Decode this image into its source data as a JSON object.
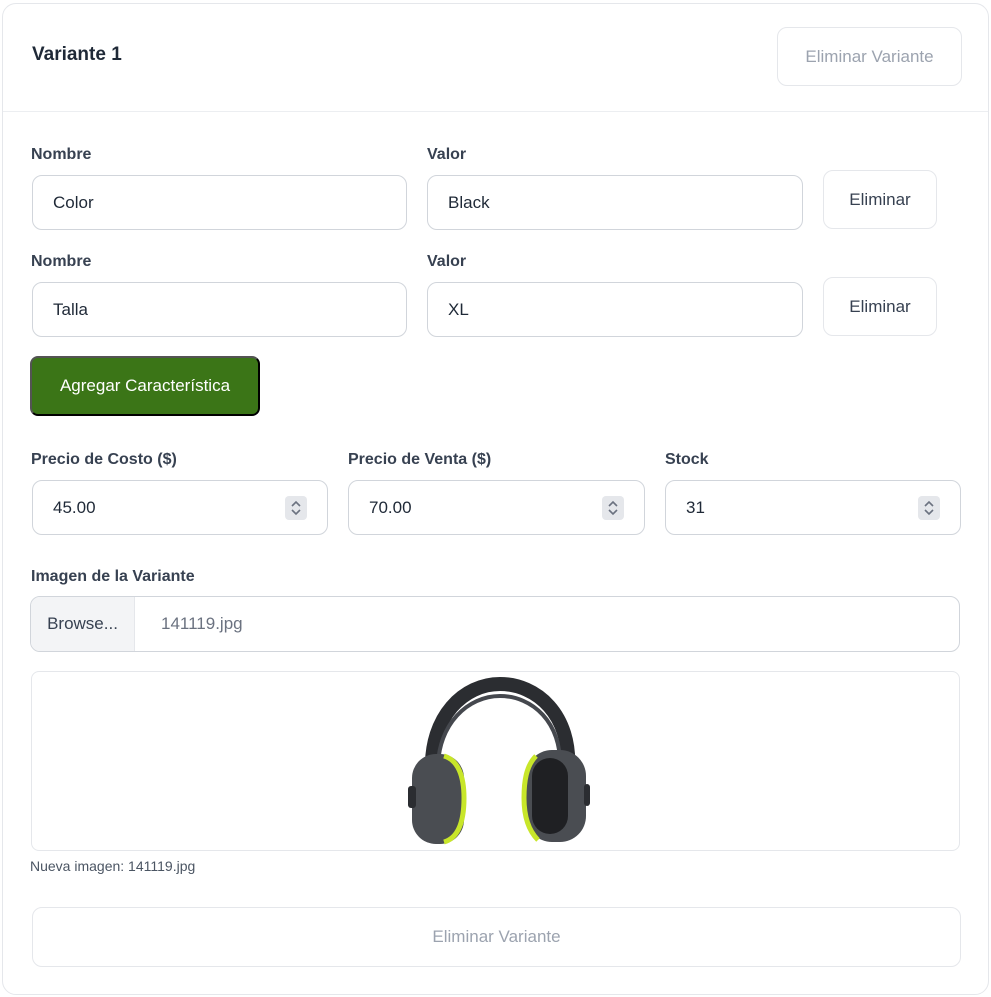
{
  "variant": {
    "title": "Variante 1",
    "remove_variant_label": "Eliminar Variante"
  },
  "characteristics": [
    {
      "name_label": "Nombre",
      "name_value": "Color",
      "value_label": "Valor",
      "value_value": "Black",
      "remove_label": "Eliminar"
    },
    {
      "name_label": "Nombre",
      "name_value": "Talla",
      "value_label": "Valor",
      "value_value": "XL",
      "remove_label": "Eliminar"
    }
  ],
  "add_characteristic_label": "Agregar Característica",
  "pricing": {
    "cost_label": "Precio de Costo ($)",
    "cost_value": "45.00",
    "sale_label": "Precio de Venta ($)",
    "sale_value": "70.00",
    "stock_label": "Stock",
    "stock_value": "31"
  },
  "image": {
    "label": "Imagen de la Variante",
    "browse_label": "Browse...",
    "file_name": "141119.jpg",
    "preview_subject": "earmuffs-headphones",
    "caption": "Nueva imagen: 141119.jpg"
  },
  "colors": {
    "primary_green": "#3b7517",
    "border": "#d1d5db",
    "muted_text": "#9ca3af",
    "accent_yellow": "#c8e62a"
  }
}
